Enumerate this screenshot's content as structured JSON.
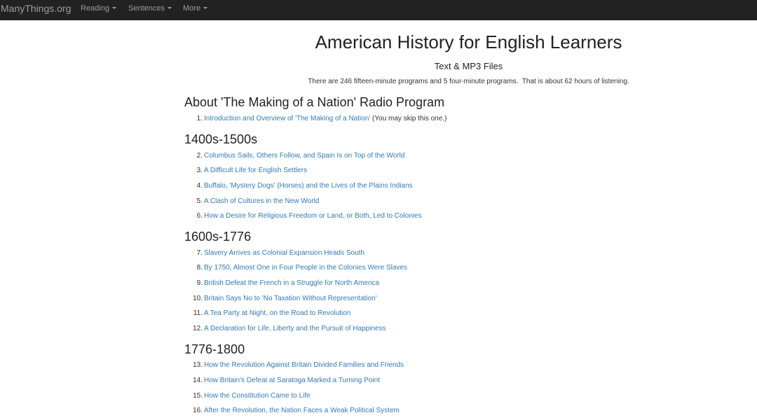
{
  "navbar": {
    "brand": "ManyThings.org",
    "items": [
      {
        "label": "Reading"
      },
      {
        "label": "Sentences"
      },
      {
        "label": "More"
      }
    ]
  },
  "page": {
    "title": "American History for English Learners",
    "subtitle": "Text & MP3 Files",
    "intro": "There are 246 fifteen-minute programs and 5 four-minute programs.  That is about 62 hours of listening."
  },
  "sections": [
    {
      "heading": "About 'The Making of a Nation' Radio Program",
      "items": [
        {
          "num": "1.",
          "title": "Introduction and Overview of 'The Making of a Nation'",
          "note": " (You may skip this one.)"
        }
      ]
    },
    {
      "heading": "1400s-1500s",
      "items": [
        {
          "num": "2.",
          "title": "Columbus Sails, Others Follow, and Spain Is on Top of the World"
        },
        {
          "num": "3.",
          "title": "A Difficult Life for English Settlers"
        },
        {
          "num": "4.",
          "title": "Buffalo, 'Mystery Dogs' (Horses) and the Lives of the Plains Indians"
        },
        {
          "num": "5.",
          "title": "A Clash of Cultures in the New World"
        },
        {
          "num": "6.",
          "title": "How a Desire for Religious Freedom or Land, or Both, Led to Colonies"
        }
      ]
    },
    {
      "heading": "1600s-1776",
      "items": [
        {
          "num": "7.",
          "title": "Slavery Arrives as Colonial Expansion Heads South"
        },
        {
          "num": "8.",
          "title": "By 1750, Almost One in Four People in the Colonies Were Slaves"
        },
        {
          "num": "9.",
          "title": "British Defeat the French in a Struggle for North America"
        },
        {
          "num": "10.",
          "title": "Britain Says No to 'No Taxation Without Representation'"
        },
        {
          "num": "11.",
          "title": "A Tea Party at Night, on the Road to Revolution"
        },
        {
          "num": "12.",
          "title": "A Declaration for Life, Liberty and the Pursuit of Happiness"
        }
      ]
    },
    {
      "heading": "1776-1800",
      "items": [
        {
          "num": "13.",
          "title": "How the Revolution Against Britain Divided Families and Friends"
        },
        {
          "num": "14.",
          "title": "How Britain's Defeat at Saratoga Marked a Turning Point"
        },
        {
          "num": "15.",
          "title": "How the Constitution Came to Life"
        },
        {
          "num": "16.",
          "title": "After the Revolution, the Nation Faces a Weak Political System"
        }
      ]
    }
  ]
}
